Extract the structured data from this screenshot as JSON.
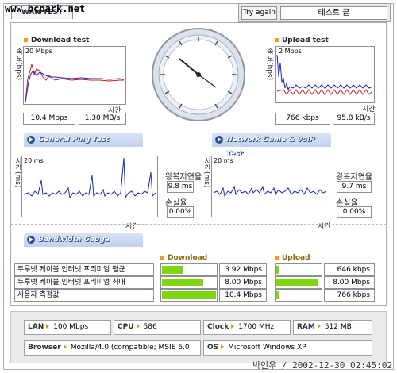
{
  "watermark": "www.bcpark.net",
  "tab": "WAN TEST",
  "try_again": "Try again",
  "status": "테스트 끝",
  "download": {
    "title": "Download test",
    "y_axis": "속도(bps)",
    "scale": "20 Mbps",
    "x_axis": "시간",
    "speed_bps": "10.4 Mbps",
    "speed_Bps": "1.30 MB/s"
  },
  "upload": {
    "title": "Upload test",
    "y_axis": "속도(bps)",
    "scale": "2 Mbps",
    "x_axis": "시간",
    "speed_bps": "766 kbps",
    "speed_Bps": "95.8 kB/s"
  },
  "ping": {
    "banner": "General Ping Test",
    "y_axis": "시간(ms)",
    "scale": "20 ms",
    "x_axis": "시간",
    "rtt_label": "왕복지연율",
    "rtt_value": "9.8 ms",
    "loss_label": "손실율",
    "loss_value": "0.00%"
  },
  "game": {
    "banner": "Network Game & VoIP Test",
    "y_axis": "시간(ms)",
    "scale": "20 ms",
    "x_axis": "시간",
    "rtt_label": "왕복지연율",
    "rtt_value": "9.7 ms",
    "loss_label": "손실율",
    "loss_value": "0.00%"
  },
  "gauge": {
    "banner": "Bandwidth Gauge",
    "download_head": "Download",
    "upload_head": "Upload",
    "rows": [
      {
        "name": "두루넷 케이블 인터넷 프리미엄 평균",
        "dl": "3.92 Mbps",
        "dl_frac": 0.38,
        "ul": "646 kbps",
        "ul_frac": 0.06
      },
      {
        "name": "두루넷 케이블 인터넷 프리미엄 최대",
        "dl": "8.00 Mbps",
        "dl_frac": 0.77,
        "ul": "8.00 Mbps",
        "ul_frac": 0.95
      },
      {
        "name": "사용자 측정값",
        "dl": "10.4 Mbps",
        "dl_frac": 1.0,
        "ul": "766 kbps",
        "ul_frac": 0.07
      }
    ]
  },
  "system": {
    "lan_label": "LAN",
    "lan": "100 Mbps",
    "cpu_label": "CPU",
    "cpu": "586",
    "clock_label": "Clock",
    "clock": "1700 MHz",
    "ram_label": "RAM",
    "ram": "512 MB",
    "browser_label": "Browser",
    "browser": "Mozilla/4.0 (compatible; MSIE 6.0",
    "os_label": "OS",
    "os": "Microsoft Windows XP"
  },
  "footer": "박인우 / 2002-12-30 02:45:02",
  "colors": {
    "accent": "#f29b22",
    "gauge_fill": "#7fd60f",
    "banner": "#c4d2ee",
    "graph_red": "#cc1b1b",
    "graph_blue": "#1b28b6"
  }
}
